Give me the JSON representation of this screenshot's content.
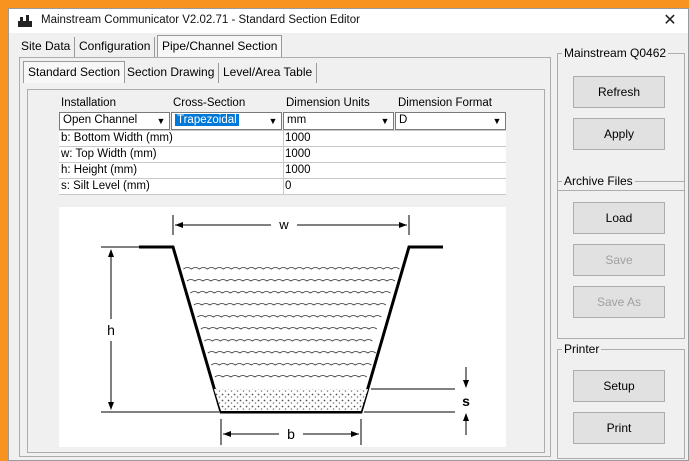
{
  "window": {
    "title": "Mainstream Communicator V2.02.71 -  Standard Section Editor",
    "close_glyph": "✕"
  },
  "main_tabs": [
    "Site Data",
    "Configuration",
    "Pipe/Channel Section"
  ],
  "sub_tabs": [
    "Standard Section",
    "Section Drawing",
    "Level/Area Table"
  ],
  "fields": {
    "installation": {
      "label": "Installation",
      "value": "Open Channel"
    },
    "cross_section": {
      "label": "Cross-Section",
      "value": "Trapezoidal"
    },
    "dimension_units": {
      "label": "Dimension Units",
      "value": "mm"
    },
    "dimension_format": {
      "label": "Dimension Format",
      "value": "D"
    }
  },
  "dimensions": [
    {
      "name": "b: Bottom Width (mm)",
      "value": "1000"
    },
    {
      "name": "w: Top Width (mm)",
      "value": "1000"
    },
    {
      "name": "h: Height (mm)",
      "value": "1000"
    },
    {
      "name": "s: Silt Level (mm)",
      "value": "0"
    }
  ],
  "diagram": {
    "label_w": "w",
    "label_h": "h",
    "label_s": "s",
    "label_b": "b"
  },
  "groups": {
    "device": {
      "title": "Mainstream Q0462",
      "buttons": [
        "Refresh",
        "Apply"
      ]
    },
    "archive": {
      "title": "Archive Files",
      "buttons": [
        "Load",
        "Save",
        "Save As"
      ]
    },
    "printer": {
      "title": "Printer",
      "buttons": [
        "Setup",
        "Print"
      ]
    }
  },
  "colors": {
    "accent": "#0078d7",
    "frame": "#f7931e"
  },
  "icons": {
    "app": "app-icon",
    "close": "close-icon",
    "dropdown": "chevron-down-icon"
  }
}
